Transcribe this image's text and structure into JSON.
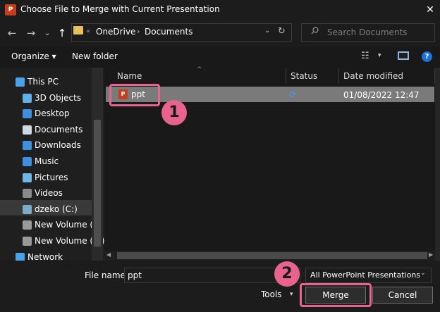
{
  "window": {
    "title": "Choose File to Merge with Current Presentation",
    "app_icon_label": "P",
    "close_glyph": "✕"
  },
  "nav_buttons": {
    "back": "←",
    "forward": "→",
    "dropdown": "⌄",
    "up": "↑"
  },
  "address": {
    "overflow": "«",
    "segments": [
      "OneDrive",
      "Documents"
    ],
    "separator": "›",
    "dropdown": "⌄",
    "refresh": "↻"
  },
  "search": {
    "placeholder": "Search Documents",
    "icon": "search-icon"
  },
  "toolbar": {
    "organize_label": "Organize ▾",
    "new_folder_label": "New folder",
    "view_glyph": "☷",
    "view_drop": "▾",
    "help_glyph": "?"
  },
  "nav_pane": {
    "items": [
      {
        "label": "This PC",
        "icon": "computer-icon",
        "color": "#4aa3e8"
      },
      {
        "label": "3D Objects",
        "icon": "cube-icon",
        "color": "#5fb0e8"
      },
      {
        "label": "Desktop",
        "icon": "desktop-icon",
        "color": "#3d8fe0"
      },
      {
        "label": "Documents",
        "icon": "document-icon",
        "color": "#cfd8e3"
      },
      {
        "label": "Downloads",
        "icon": "download-icon",
        "color": "#3d8fe0"
      },
      {
        "label": "Music",
        "icon": "music-icon",
        "color": "#3d8fe0"
      },
      {
        "label": "Pictures",
        "icon": "pictures-icon",
        "color": "#6fb6e8"
      },
      {
        "label": "Videos",
        "icon": "video-icon",
        "color": "#8a8a8a"
      },
      {
        "label": "dzeko (C:)",
        "icon": "drive-icon",
        "color": "#7fa9c9"
      },
      {
        "label": "New Volume (D:",
        "icon": "drive-icon",
        "color": "#9a9a9a"
      },
      {
        "label": "New Volume (E:)",
        "icon": "drive-icon",
        "color": "#9a9a9a"
      },
      {
        "label": "Network",
        "icon": "network-icon",
        "color": "#4aa3e8"
      }
    ],
    "selected_index": 8
  },
  "columns": [
    "Name",
    "Status",
    "Date modified"
  ],
  "sort_glyph": "^",
  "files": [
    {
      "name": "ppt",
      "icon_label": "P",
      "status_glyph": "⟳",
      "date_modified": "01/08/2022 12:47"
    }
  ],
  "scroll": {
    "left": "◀",
    "right": "▶"
  },
  "bottom": {
    "filename_label": "File name:",
    "filename_value": "ppt",
    "filetype_value": "All PowerPoint Presentations",
    "filetype_chevron": "⌄",
    "tools_label": "Tools",
    "tools_chevron": "▾",
    "merge_label": "Merge",
    "cancel_label": "Cancel"
  },
  "annotations": {
    "callout_1": "1",
    "callout_2": "2",
    "color": "#e9638f"
  }
}
